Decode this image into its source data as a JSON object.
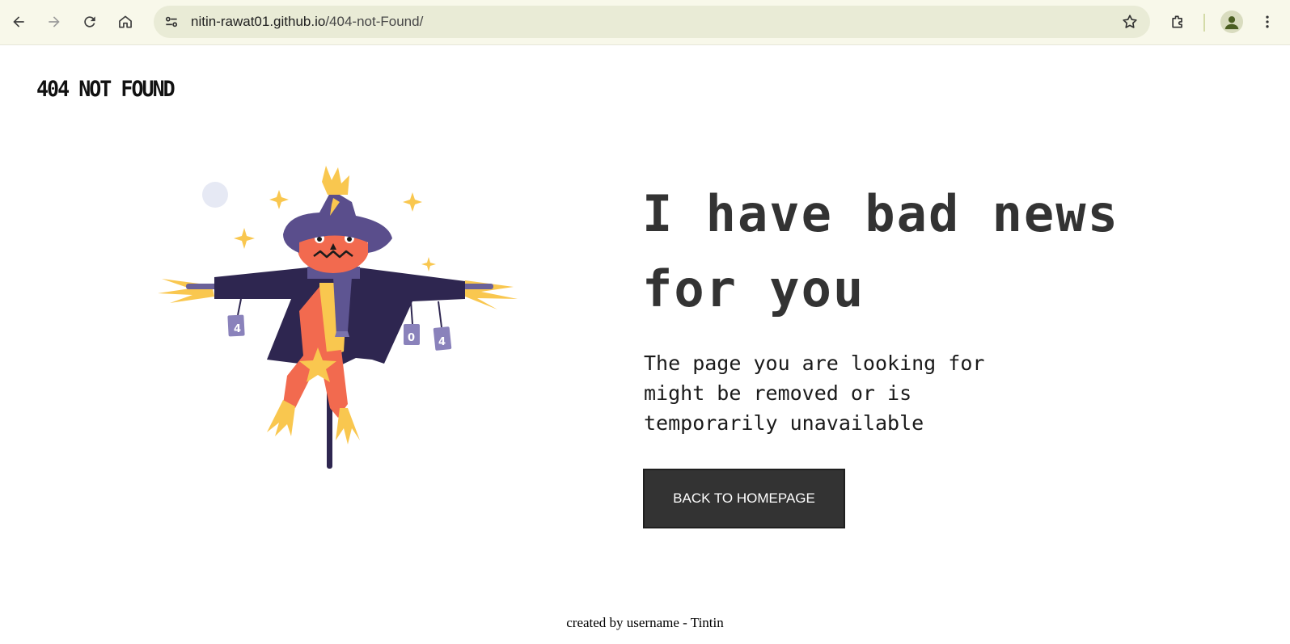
{
  "browser": {
    "url_host": "nitin-rawat01.github.io",
    "url_path": "/404-not-Found/",
    "icons": [
      "back-icon",
      "forward-icon",
      "reload-icon",
      "home-icon",
      "site-info-icon",
      "bookmark-star-icon",
      "extensions-icon",
      "profile-icon",
      "menu-icon"
    ]
  },
  "page": {
    "brand": "404 NOT FOUND",
    "headline_line1": "I have bad news",
    "headline_line2": "for you",
    "sub_line1": "The page you are looking for",
    "sub_line2": "might be removed or is",
    "sub_line3": "temporarily unavailable",
    "button_label": "BACK TO HOMEPAGE",
    "footer": "created by username - Tintin",
    "can_labels": [
      "4",
      "0",
      "4"
    ]
  },
  "colors": {
    "dark": "#333333",
    "hat": "#5a4e8c",
    "coat": "#2e2650",
    "pumpkin": "#f26a4f",
    "straw": "#f9c74f",
    "scarf": "#5e5592"
  }
}
